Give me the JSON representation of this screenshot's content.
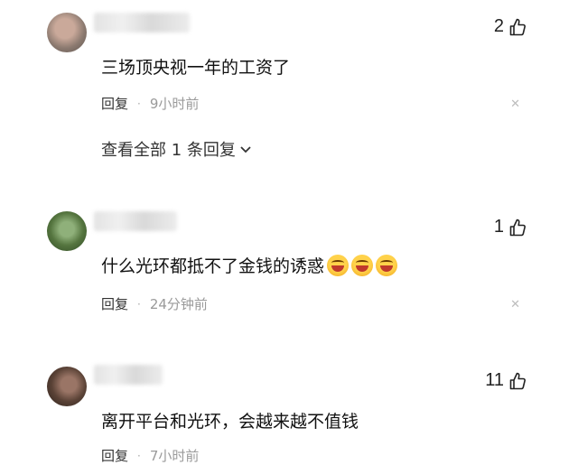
{
  "comments": [
    {
      "likes": "2",
      "text": "三场顶央视一年的工资了",
      "reply_label": "回复",
      "time": "9小时前",
      "view_replies": "查看全部 1 条回复"
    },
    {
      "likes": "1",
      "text": "什么光环都抵不了金钱的诱惑",
      "emojis": [
        "grin-squint-emoji",
        "grin-squint-emoji",
        "grin-squint-emoji"
      ],
      "reply_label": "回复",
      "time": "24分钟前"
    },
    {
      "likes": "11",
      "text": "离开平台和光环，会越来越不值钱",
      "reply_label": "回复",
      "time": "7小时前"
    }
  ],
  "icons": {
    "like": "thumb-up-outline-icon",
    "close": "close-icon",
    "expand": "chevron-down-icon"
  },
  "colors": {
    "text": "#111111",
    "meta": "#9a9a9a",
    "background": "#ffffff"
  }
}
